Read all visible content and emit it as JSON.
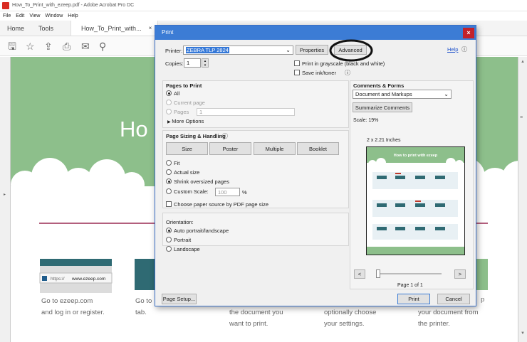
{
  "window": {
    "title": "How_To_Print_with_ezeep.pdf - Adobe Acrobat Pro DC"
  },
  "menu": [
    "File",
    "Edit",
    "View",
    "Window",
    "Help"
  ],
  "tabs": {
    "home": "Home",
    "tools": "Tools",
    "document": "How_To_Print_with...",
    "close": "×"
  },
  "document": {
    "heading_partial": "Ho",
    "url_text": "www.ezeep.com",
    "url_prefix": "https://",
    "steps": [
      {
        "line1": "Go to ezeep.com",
        "line2": "and log in or register."
      },
      {
        "line1": "Go to",
        "line2": "tab."
      },
      {
        "line1": "the document you",
        "line2": "want to print."
      },
      {
        "line1": "optionally choose",
        "line2": "your settings."
      },
      {
        "line1": "your document from",
        "line2": "the printer."
      }
    ],
    "step5_partial_top": "p"
  },
  "dialog": {
    "title": "Print",
    "close": "×",
    "printer_label": "Printer:",
    "printer_value": "ZEBRA TLP 2824",
    "properties": "Properties",
    "advanced": "Advanced",
    "help": "Help",
    "copies_label": "Copies:",
    "copies_value": "1",
    "grayscale": "Print in grayscale (black and white)",
    "save_ink": "Save ink/toner",
    "pages_to_print": "Pages to Print",
    "all": "All",
    "current_page": "Current page",
    "pages": "Pages",
    "pages_value": "1",
    "more_options": "More Options",
    "sizing_heading": "Page Sizing & Handling",
    "size_tabs": [
      "Size",
      "Poster",
      "Multiple",
      "Booklet"
    ],
    "fit": "Fit",
    "actual_size": "Actual size",
    "shrink": "Shrink oversized pages",
    "custom_scale": "Custom Scale:",
    "custom_scale_value": "100",
    "percent": "%",
    "paper_source": "Choose paper source by PDF page size",
    "orientation": "Orientation:",
    "auto": "Auto portrait/landscape",
    "portrait": "Portrait",
    "landscape": "Landscape",
    "comments_heading": "Comments & Forms",
    "comments_value": "Document and Markups",
    "summarize": "Summarize Comments",
    "scale": "Scale: 19%",
    "preview_size": "2 x 2.21 Inches",
    "preview_title": "How to print with ezeep",
    "prev": "<",
    "next": ">",
    "page_of": "Page 1 of 1",
    "page_setup": "Page Setup...",
    "print": "Print",
    "cancel": "Cancel"
  }
}
